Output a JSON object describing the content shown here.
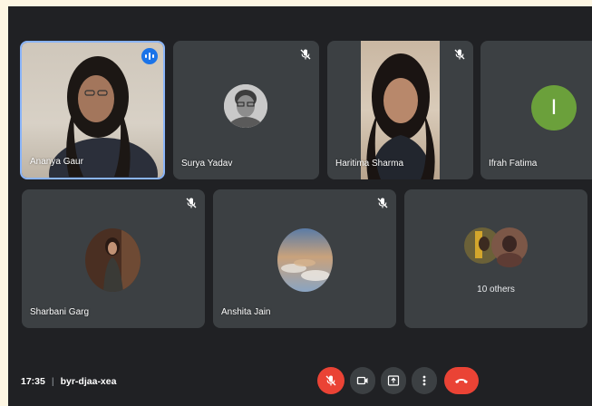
{
  "participants": [
    {
      "name": "Ananya Gaur",
      "speaking": true
    },
    {
      "name": "Surya Yadav",
      "muted": true
    },
    {
      "name": "Haritima Sharma",
      "muted": true
    },
    {
      "name": "Ifrah Fatima",
      "initial": "I",
      "avatar_color": "#6ba03b"
    },
    {
      "name": "Sharbani Garg",
      "muted": true
    },
    {
      "name": "Anshita Jain",
      "muted": true
    }
  ],
  "others": {
    "label": "10 others"
  },
  "meeting": {
    "time": "17:35",
    "separator": "|",
    "code": "byr-djaa-xea"
  },
  "colors": {
    "background": "#202124",
    "tile": "#3c4043",
    "active_border": "#8ab4f8",
    "end_call": "#ea4335",
    "speaking_badge": "#1a73e8"
  },
  "controls": [
    "mic-off-icon",
    "camera-icon",
    "present-icon",
    "more-options-icon",
    "end-call-icon"
  ]
}
